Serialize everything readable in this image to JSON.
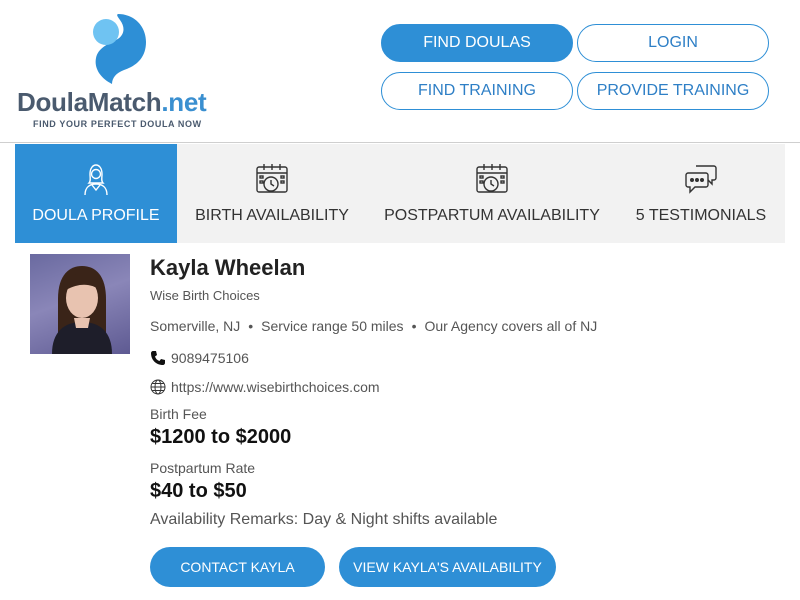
{
  "brand": {
    "name_main": "DoulaMatch",
    "name_suffix": ".net",
    "tagline": "FIND YOUR PERFECT DOULA NOW",
    "accent_color": "#2e8fd6"
  },
  "nav": {
    "find_doulas": "FIND DOULAS",
    "login": "LOGIN",
    "find_training": "FIND TRAINING",
    "provide_training": "PROVIDE TRAINING"
  },
  "tabs": [
    {
      "label": "DOULA PROFILE",
      "icon": "doula-person-icon",
      "active": true
    },
    {
      "label": "BIRTH AVAILABILITY",
      "icon": "calendar-clock-icon",
      "active": false
    },
    {
      "label": "POSTPARTUM AVAILABILITY",
      "icon": "calendar-clock-icon",
      "active": false
    },
    {
      "label": "5 TESTIMONIALS",
      "icon": "chat-bubbles-icon",
      "active": false
    }
  ],
  "profile": {
    "name": "Kayla Wheelan",
    "agency": "Wise Birth Choices",
    "location": "Somerville, NJ",
    "service_range": "Service range 50 miles",
    "coverage": "Our Agency covers all of NJ",
    "phone": "9089475106",
    "website": "https://www.wisebirthchoices.com",
    "birth_fee_label": "Birth Fee",
    "birth_fee": "$1200 to $2000",
    "postpartum_label": "Postpartum Rate",
    "postpartum_rate": "$40 to $50",
    "remarks": "Availability Remarks: Day & Night shifts available"
  },
  "actions": {
    "contact": "CONTACT KAYLA",
    "availability": "VIEW KAYLA'S AVAILABILITY"
  }
}
